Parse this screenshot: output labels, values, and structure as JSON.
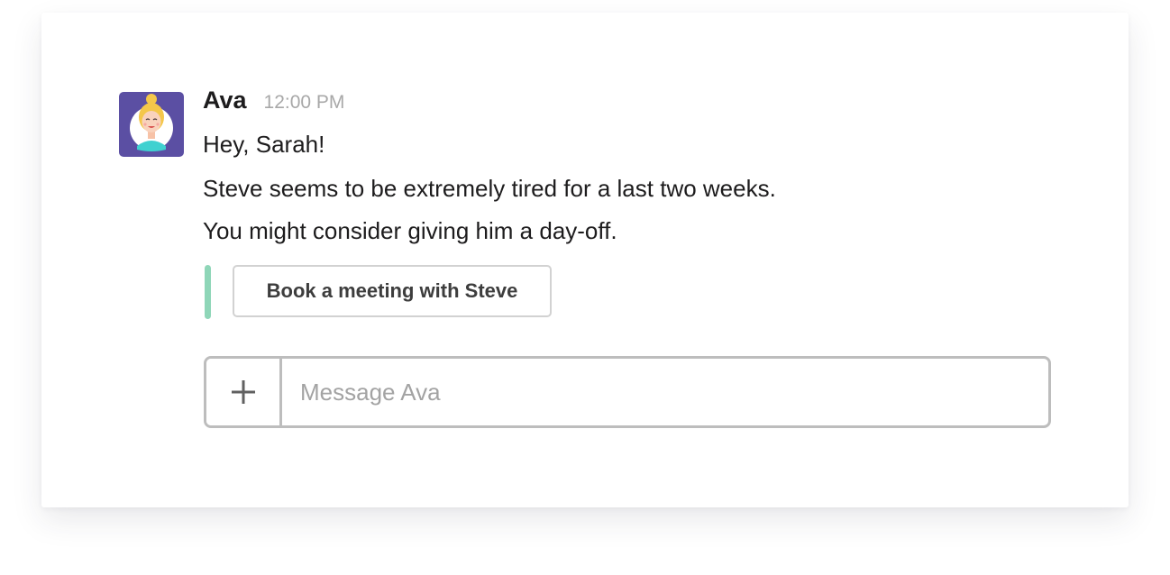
{
  "message": {
    "sender": "Ava",
    "timestamp": "12:00 PM",
    "lines": [
      "Hey, Sarah!",
      "Steve seems to be extremely tired for a last two weeks.",
      "You might consider giving him a day-off."
    ],
    "action_button_label": "Book a meeting with Steve",
    "avatar_icon": "woman-avatar-icon"
  },
  "composer": {
    "placeholder": "Message Ava",
    "attach_icon": "plus-icon"
  },
  "colors": {
    "avatar_background": "#5b4fa3",
    "accent_bar": "#8fd6b8",
    "timestamp": "#a8a8a8",
    "border": "#bdbdbd"
  }
}
